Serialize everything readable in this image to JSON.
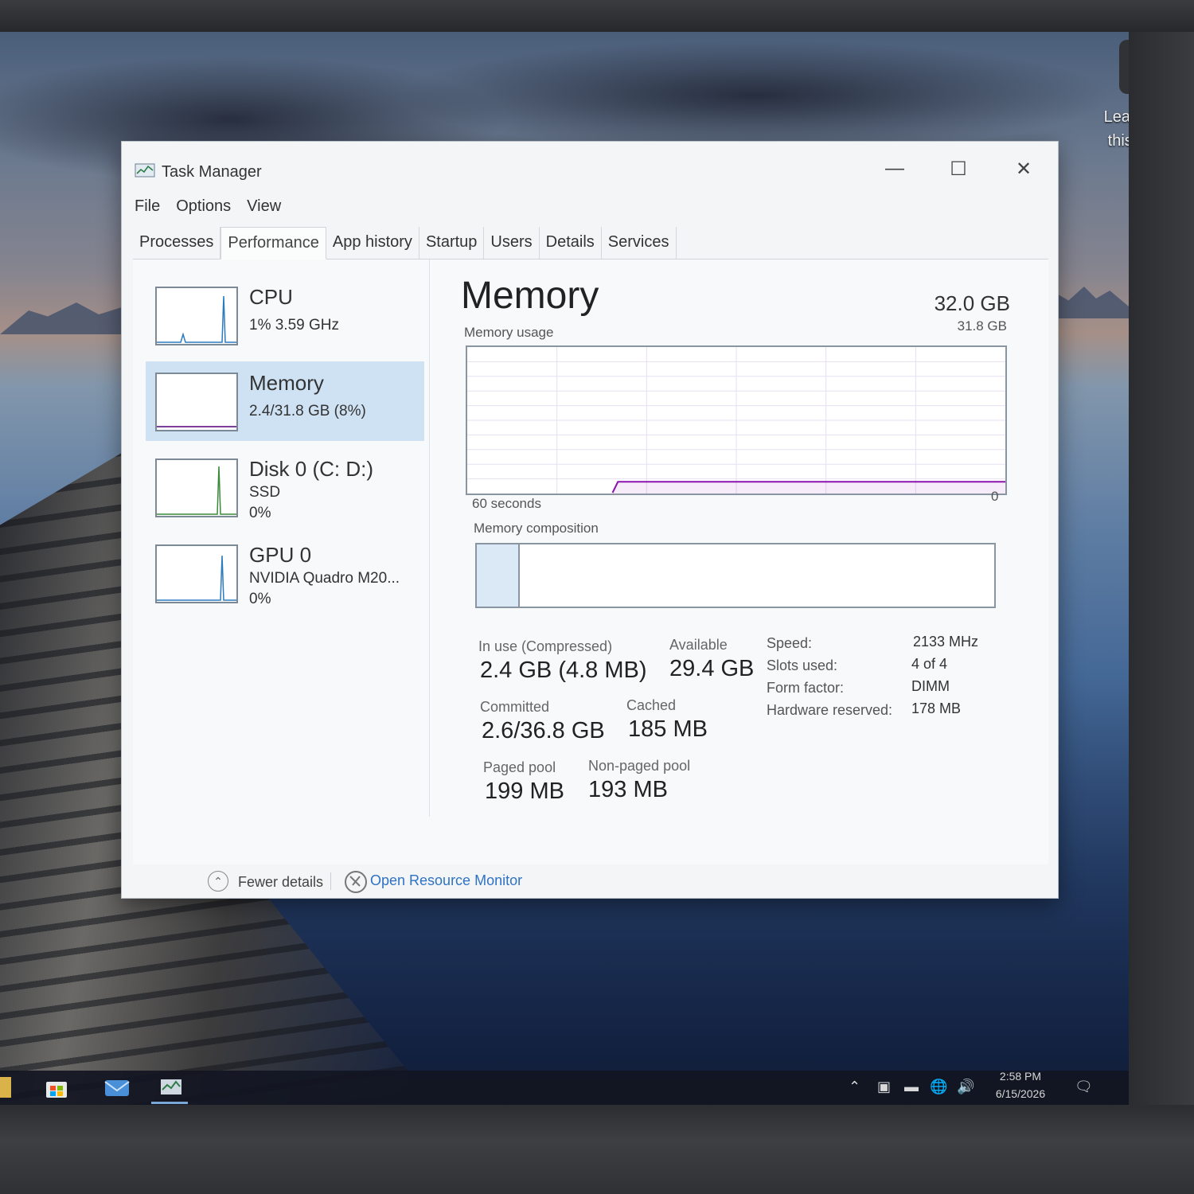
{
  "desktop": {
    "learn_label_line1": "Learn about",
    "learn_label_line2": "this picture"
  },
  "taskbar": {
    "time": "2:58 PM",
    "date": "6/15/2026"
  },
  "window": {
    "title": "Task Manager",
    "menu": [
      "File",
      "Options",
      "View"
    ],
    "tabs": [
      "Processes",
      "Performance",
      "App history",
      "Startup",
      "Users",
      "Details",
      "Services"
    ],
    "active_tab": "Performance"
  },
  "sidebar": {
    "items": [
      {
        "title": "CPU",
        "sub1": "1%  3.59 GHz",
        "sub2": ""
      },
      {
        "title": "Memory",
        "sub1": "2.4/31.8 GB (8%)",
        "sub2": ""
      },
      {
        "title": "Disk 0 (C: D:)",
        "sub1": "SSD",
        "sub2": "0%"
      },
      {
        "title": "GPU 0",
        "sub1": "NVIDIA Quadro M20...",
        "sub2": "0%"
      }
    ],
    "selected": "Memory"
  },
  "main": {
    "title": "Memory",
    "total": "32.0 GB",
    "usage_label": "Memory usage",
    "usage_max": "31.8 GB",
    "time_span": "60 seconds",
    "zero": "0",
    "composition_label": "Memory composition",
    "usage_fraction": 0.08,
    "stats": {
      "in_use_label": "In use (Compressed)",
      "in_use_value": "2.4 GB (4.8 MB)",
      "available_label": "Available",
      "available_value": "29.4 GB",
      "committed_label": "Committed",
      "committed_value": "2.6/36.8 GB",
      "cached_label": "Cached",
      "cached_value": "185 MB",
      "paged_label": "Paged pool",
      "paged_value": "199 MB",
      "nonpaged_label": "Non-paged pool",
      "nonpaged_value": "193 MB"
    },
    "details": {
      "speed_label": "Speed:",
      "speed_value": "2133 MHz",
      "slots_label": "Slots used:",
      "slots_value": "4 of 4",
      "form_label": "Form factor:",
      "form_value": "DIMM",
      "hw_label": "Hardware reserved:",
      "hw_value": "178 MB"
    }
  },
  "footer": {
    "fewer_details": "Fewer details",
    "open_monitor": "Open Resource Monitor"
  },
  "colors": {
    "accent_link": "#2f72c4",
    "selected_bg": "#cfe2f3",
    "graph_border": "#8a95a2"
  }
}
